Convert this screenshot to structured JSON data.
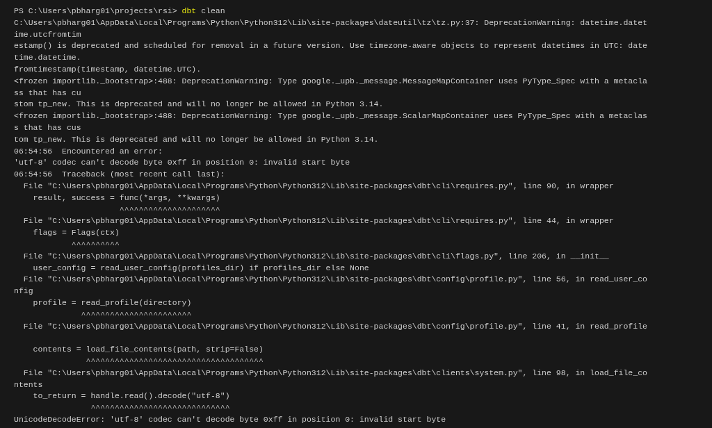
{
  "terminal": {
    "prompt": {
      "path": "PS C:\\Users\\pbharg01\\projects\\rsi>",
      "command": "dbt",
      "args": "clean"
    },
    "lines": [
      {
        "text": "C:\\Users\\pbharg01\\AppData\\Local\\Programs\\Python\\Python312\\Lib\\site-packages\\dateutil\\tz\\tz.py:37: DeprecationWarning: datetime.datet"
      },
      {
        "text": "ime.utcfromtim"
      },
      {
        "text": "estamp() is deprecated and scheduled for removal in a future version. Use timezone-aware objects to represent datetimes in UTC: date"
      },
      {
        "text": "time.datetime."
      },
      {
        "text": "fromtimestamp(timestamp, datetime.UTC)."
      },
      {
        "text": "<frozen importlib._bootstrap>:488: DeprecationWarning: Type google._upb._message.MessageMapContainer uses PyType_Spec with a metacla"
      },
      {
        "text": "ss that has cu"
      },
      {
        "text": "stom tp_new. This is deprecated and will no longer be allowed in Python 3.14."
      },
      {
        "text": "<frozen importlib._bootstrap>:488: DeprecationWarning: Type google._upb._message.ScalarMapContainer uses PyType_Spec with a metaclas"
      },
      {
        "text": "s that has cus"
      },
      {
        "text": "tom tp_new. This is deprecated and will no longer be allowed in Python 3.14."
      },
      {
        "text": "06:54:56  Encountered an error:"
      },
      {
        "text": "'utf-8' codec can't decode byte 0xff in position 0: invalid start byte"
      },
      {
        "text": "06:54:56  Traceback (most recent call last):"
      },
      {
        "text": "  File \"C:\\Users\\pbharg01\\AppData\\Local\\Programs\\Python\\Python312\\Lib\\site-packages\\dbt\\cli\\requires.py\", line 90, in wrapper"
      },
      {
        "text": "    result, success = func(*args, **kwargs)"
      },
      {
        "kind": "carets",
        "text": "                      ^^^^^^^^^^^^^^^^^^^^^"
      },
      {
        "text": "  File \"C:\\Users\\pbharg01\\AppData\\Local\\Programs\\Python\\Python312\\Lib\\site-packages\\dbt\\cli\\requires.py\", line 44, in wrapper"
      },
      {
        "text": "    flags = Flags(ctx)"
      },
      {
        "kind": "carets",
        "text": "            ^^^^^^^^^^"
      },
      {
        "text": "  File \"C:\\Users\\pbharg01\\AppData\\Local\\Programs\\Python\\Python312\\Lib\\site-packages\\dbt\\cli\\flags.py\", line 206, in __init__"
      },
      {
        "text": "    user_config = read_user_config(profiles_dir) if profiles_dir else None"
      },
      {
        "text": "  File \"C:\\Users\\pbharg01\\AppData\\Local\\Programs\\Python\\Python312\\Lib\\site-packages\\dbt\\config\\profile.py\", line 56, in read_user_co"
      },
      {
        "text": "nfig"
      },
      {
        "text": "    profile = read_profile(directory)"
      },
      {
        "kind": "carets",
        "text": "              ^^^^^^^^^^^^^^^^^^^^^^^"
      },
      {
        "text": "  File \"C:\\Users\\pbharg01\\AppData\\Local\\Programs\\Python\\Python312\\Lib\\site-packages\\dbt\\config\\profile.py\", line 41, in read_profile"
      },
      {
        "kind": "blank"
      },
      {
        "text": "    contents = load_file_contents(path, strip=False)"
      },
      {
        "kind": "carets",
        "text": "               ^^^^^^^^^^^^^^^^^^^^^^^^^^^^^^^^^^^^^"
      },
      {
        "text": "  File \"C:\\Users\\pbharg01\\AppData\\Local\\Programs\\Python\\Python312\\Lib\\site-packages\\dbt\\clients\\system.py\", line 98, in load_file_co"
      },
      {
        "text": "ntents"
      },
      {
        "text": "    to_return = handle.read().decode(\"utf-8\")"
      },
      {
        "kind": "carets",
        "text": "                ^^^^^^^^^^^^^^^^^^^^^^^^^^^^^"
      },
      {
        "text": "UnicodeDecodeError: 'utf-8' codec can't decode byte 0xff in position 0: invalid start byte"
      }
    ]
  }
}
